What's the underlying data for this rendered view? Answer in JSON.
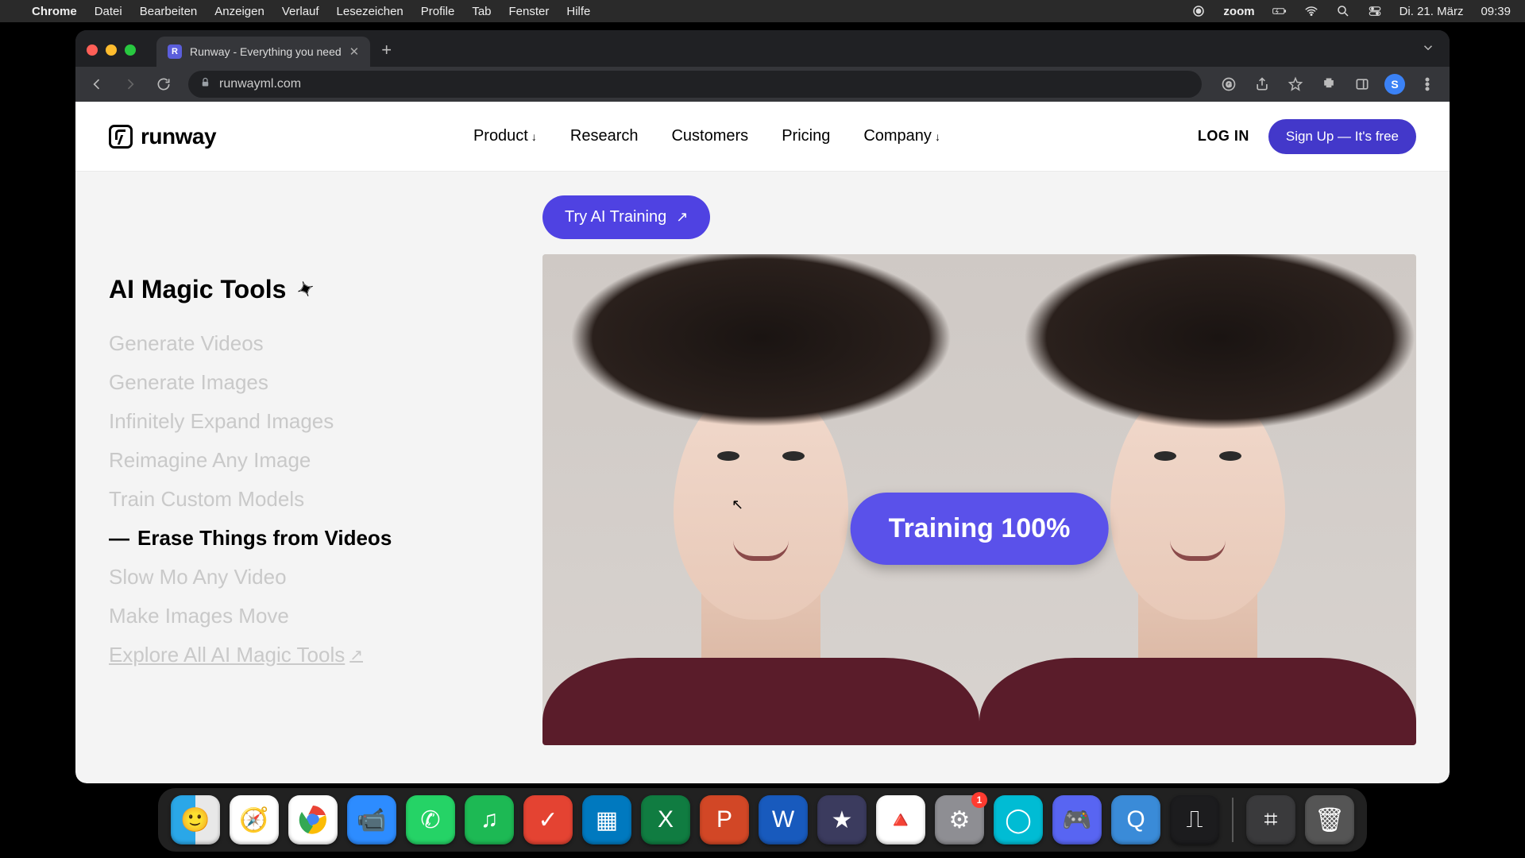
{
  "mac_menu": {
    "app": "Chrome",
    "items": [
      "Datei",
      "Bearbeiten",
      "Anzeigen",
      "Verlauf",
      "Lesezeichen",
      "Profile",
      "Tab",
      "Fenster",
      "Hilfe"
    ],
    "right": {
      "zoom": "zoom",
      "date": "Di. 21. März",
      "time": "09:39"
    }
  },
  "browser": {
    "tab_title": "Runway - Everything you need",
    "url": "runwayml.com",
    "avatar_letter": "S"
  },
  "site": {
    "brand": "runway",
    "nav": {
      "product": "Product",
      "research": "Research",
      "customers": "Customers",
      "pricing": "Pricing",
      "company": "Company"
    },
    "login": "LOG IN",
    "signup": "Sign Up — It's free",
    "cta": "Try AI Training",
    "sidebar_title": "AI Magic Tools",
    "tools": {
      "t0": "Generate Videos",
      "t1": "Generate Images",
      "t2": "Infinitely Expand Images",
      "t3": "Reimagine Any Image",
      "t4": "Train Custom Models",
      "t5": "Erase Things from Videos",
      "t6": "Slow Mo Any Video",
      "t7": "Make Images Move",
      "explore": "Explore All AI Magic Tools"
    },
    "overlay": "Training 100%"
  },
  "dock": {
    "settings_badge": "1"
  }
}
